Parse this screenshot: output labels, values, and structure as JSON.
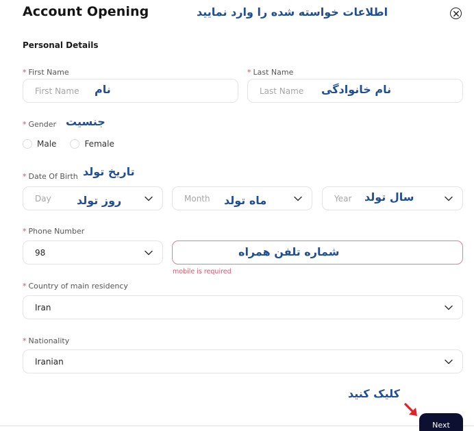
{
  "header": {
    "title": "Account Opening",
    "close_icon": "close-circle-icon"
  },
  "section": {
    "title": "Personal Details"
  },
  "fields": {
    "first_name": {
      "label": "First Name",
      "placeholder": "First Name",
      "annotation": "نام"
    },
    "last_name": {
      "label": "Last Name",
      "placeholder": "Last Name",
      "annotation": "نام خانوادگی"
    },
    "gender": {
      "label": "Gender",
      "annotation": "جنسیت",
      "options": [
        "Male",
        "Female"
      ]
    },
    "dob": {
      "label": "Date Of Birth",
      "annotation": "تاریخ تولد",
      "day": {
        "placeholder": "Day",
        "annotation": "روز تولد"
      },
      "month": {
        "placeholder": "Month",
        "annotation": "ماه تولد"
      },
      "year": {
        "placeholder": "Year",
        "annotation": "سال تولد"
      }
    },
    "phone": {
      "label": "Phone Number",
      "code": "98",
      "annotation": "شماره تلفن همراه",
      "error": "mobile is required"
    },
    "country": {
      "label": "Country of main residency",
      "value": "Iran"
    },
    "nationality": {
      "label": "Nationality",
      "value": "Iranian"
    }
  },
  "annotations": {
    "top_instruction": "اطلاعات خواسته شده را وارد نمایید",
    "click_note": "کلیک کنید"
  },
  "actions": {
    "next_label": "Next"
  },
  "colors": {
    "annotation": "#1f4e96",
    "required": "#e0485a",
    "error": "#d9546a",
    "button": "#0d1030",
    "arrow": "#e0202a"
  }
}
